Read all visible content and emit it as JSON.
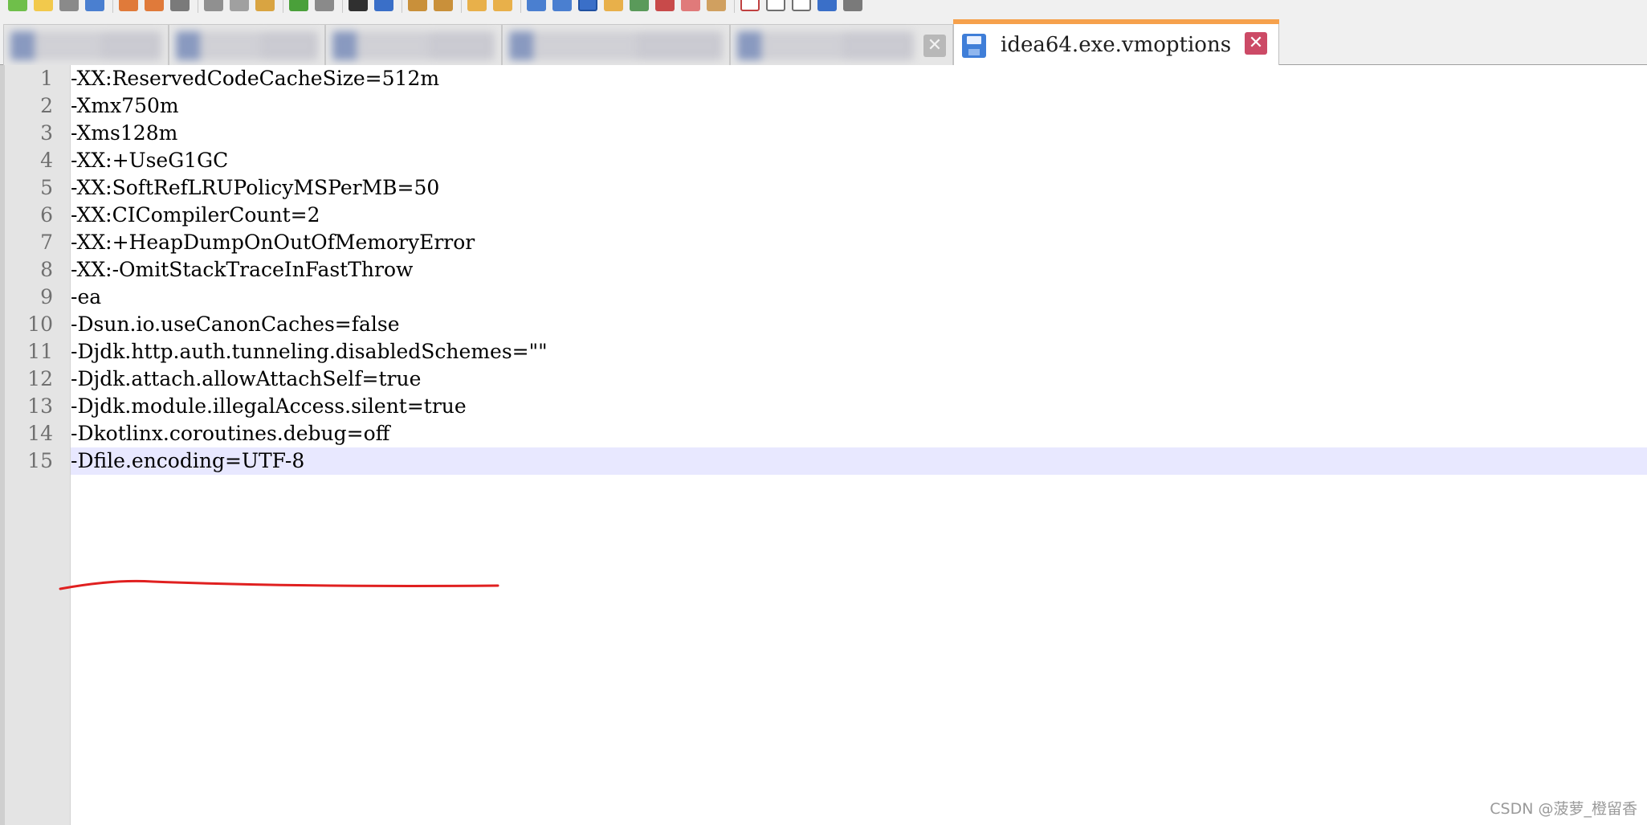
{
  "editor_tabs": [
    {
      "label": "",
      "blurred": true
    },
    {
      "label": "",
      "blurred": true
    },
    {
      "label": "",
      "blurred": true
    },
    {
      "label": "",
      "blurred": true
    },
    {
      "label": "",
      "blurred": true
    },
    {
      "label": "idea64.exe.vmoptions",
      "active": true
    }
  ],
  "active_tab": {
    "title": "idea64.exe.vmoptions",
    "close_glyph": "✕"
  },
  "inactive_close_glyph": "✕",
  "editor": {
    "current_line": 15,
    "lines": [
      {
        "n": "1",
        "text": "-XX:ReservedCodeCacheSize=512m"
      },
      {
        "n": "2",
        "text": "-Xmx750m"
      },
      {
        "n": "3",
        "text": "-Xms128m"
      },
      {
        "n": "4",
        "text": "-XX:+UseG1GC"
      },
      {
        "n": "5",
        "text": "-XX:SoftRefLRUPolicyMSPerMB=50"
      },
      {
        "n": "6",
        "text": "-XX:CICompilerCount=2"
      },
      {
        "n": "7",
        "text": "-XX:+HeapDumpOnOutOfMemoryError"
      },
      {
        "n": "8",
        "text": "-XX:-OmitStackTraceInFastThrow"
      },
      {
        "n": "9",
        "text": "-ea"
      },
      {
        "n": "10",
        "text": "-Dsun.io.useCanonCaches=false"
      },
      {
        "n": "11",
        "text": "-Djdk.http.auth.tunneling.disabledSchemes=\"\""
      },
      {
        "n": "12",
        "text": "-Djdk.attach.allowAttachSelf=true"
      },
      {
        "n": "13",
        "text": "-Djdk.module.illegalAccess.silent=true"
      },
      {
        "n": "14",
        "text": "-Dkotlinx.coroutines.debug=off"
      },
      {
        "n": "15",
        "text": "-Dfile.encoding=UTF-8"
      }
    ]
  },
  "colors": {
    "active_tab_accent": "#f6a14c",
    "close_button": "#cc4a66",
    "current_line_highlight": "#e8e8ff",
    "annotation_stroke": "#e02020"
  },
  "watermark": "CSDN @菠萝_橙留香"
}
